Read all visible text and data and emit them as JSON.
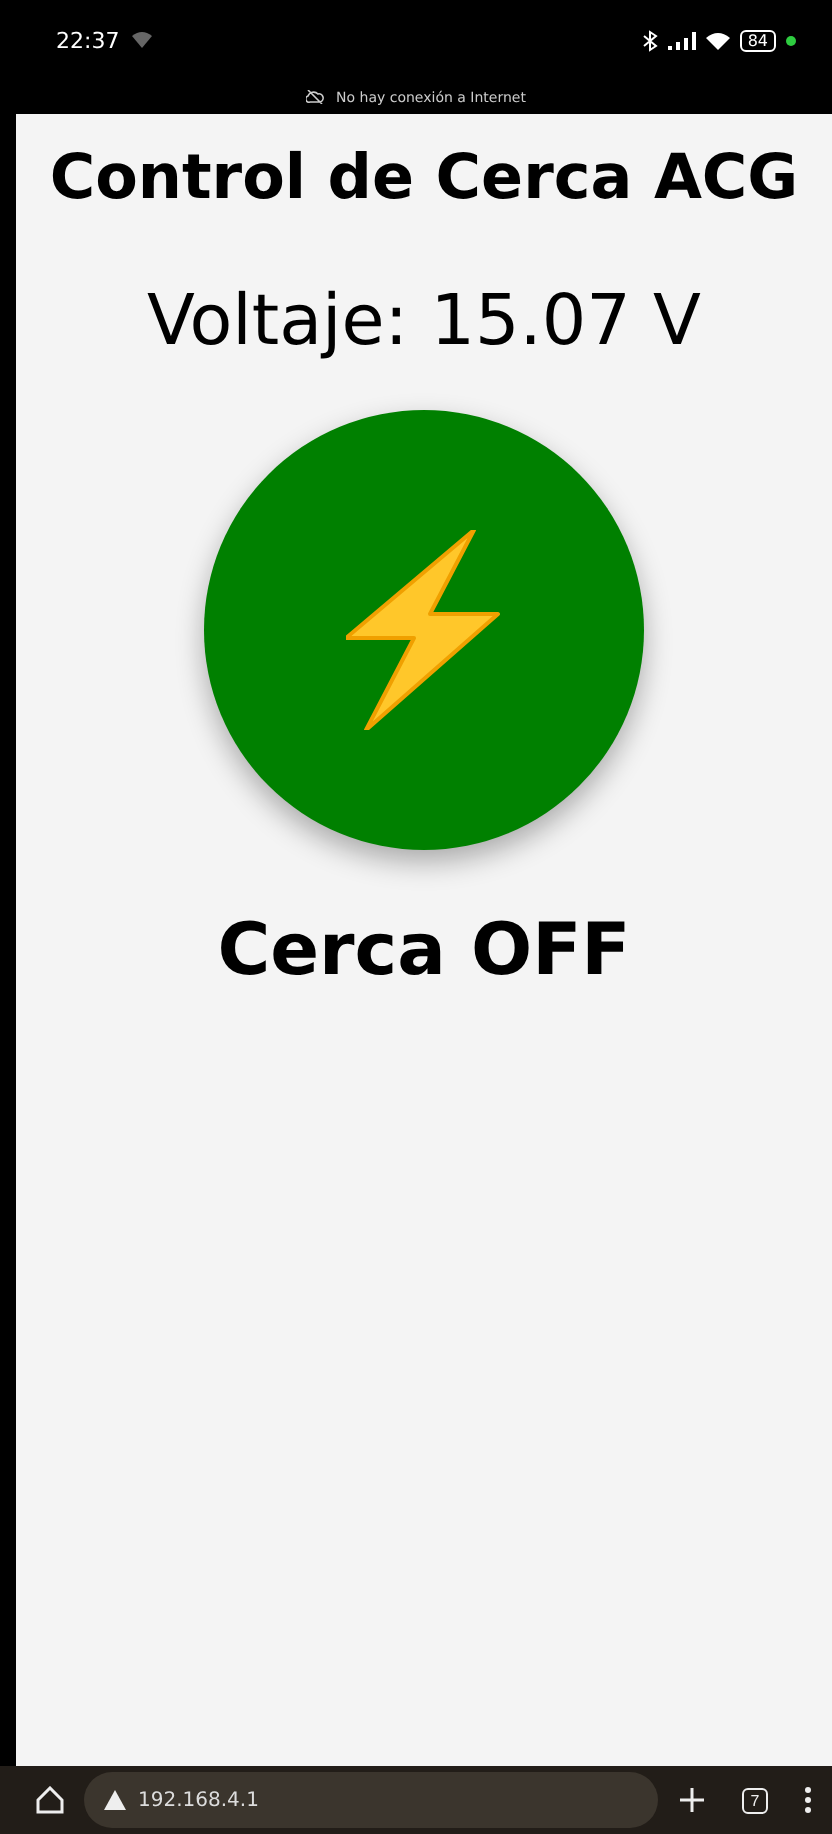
{
  "status_bar": {
    "time": "22:37",
    "battery": "84",
    "notice": "No hay conexión a Internet"
  },
  "page": {
    "title": "Control de Cerca ACG",
    "voltage": "Voltaje: 15.07 V",
    "power_button": {
      "on": false
    },
    "status": "Cerca OFF"
  },
  "browser_bar": {
    "url": "192.168.4.1",
    "tab_count": "7"
  }
}
